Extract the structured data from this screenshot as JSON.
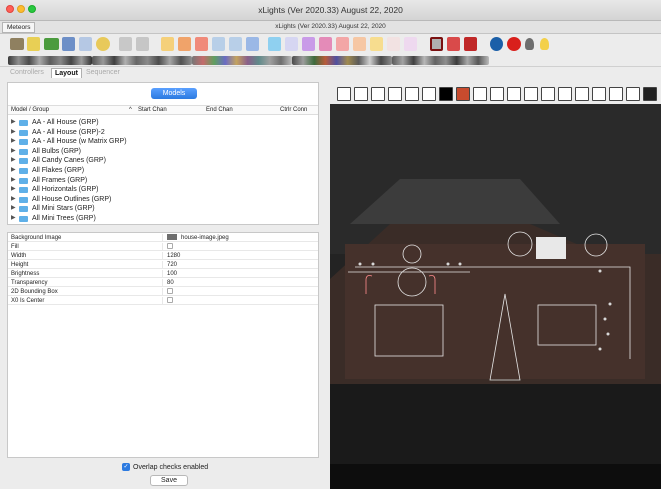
{
  "window": {
    "title": "xLights (Ver 2020.33) August 22, 2020"
  },
  "document": {
    "tab_label": "Meteors",
    "title": "xLights (Ver 2020.33) August 22, 2020"
  },
  "tabs": [
    {
      "label": "Controllers",
      "active": false
    },
    {
      "label": "Layout",
      "active": true
    },
    {
      "label": "Sequencer",
      "active": false
    }
  ],
  "models": {
    "button_label": "Models",
    "columns": [
      "Model / Group",
      "Start Chan",
      "End Chan",
      "Ctrlr Conn"
    ],
    "items": [
      {
        "label": "AA - All House (GRP)"
      },
      {
        "label": "AA - All House (GRP)-2"
      },
      {
        "label": "AA - All House (w Matrix GRP)"
      },
      {
        "label": "All Bulbs (GRP)"
      },
      {
        "label": "All Candy Canes (GRP)"
      },
      {
        "label": "All Flakes (GRP)"
      },
      {
        "label": "All Frames (GRP)"
      },
      {
        "label": "All Horizontals (GRP)"
      },
      {
        "label": "All House Outlines (GRP)"
      },
      {
        "label": "All Mini Stars (GRP)"
      },
      {
        "label": "All Mini Trees (GRP)"
      }
    ]
  },
  "properties": [
    {
      "name": "Background Image",
      "value": "house-image.jpeg",
      "type": "image"
    },
    {
      "name": "Fill",
      "value": "",
      "type": "checkbox"
    },
    {
      "name": "Width",
      "value": "1280",
      "type": "text"
    },
    {
      "name": "Height",
      "value": "720",
      "type": "text"
    },
    {
      "name": "Brightness",
      "value": "100",
      "type": "text"
    },
    {
      "name": "Transparency",
      "value": "80",
      "type": "text"
    },
    {
      "name": "2D Bounding Box",
      "value": "",
      "type": "checkbox"
    },
    {
      "name": "X0 Is Center",
      "value": "",
      "type": "checkbox"
    }
  ],
  "footer": {
    "overlap_label": "Overlap checks enabled",
    "overlap_checked": true,
    "save_label": "Save"
  },
  "colors": {
    "accent": "#2c7ae0",
    "folder": "#5fb0e8",
    "preview_bg": "#1e1e1e",
    "red_record": "#d9201c"
  }
}
